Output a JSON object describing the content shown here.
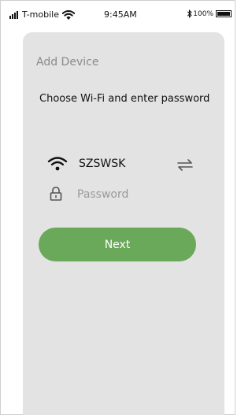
{
  "status_bar": {
    "carrier": "T-mobile",
    "time": "9:45AM",
    "battery": "100%"
  },
  "page": {
    "section_title": "Add Device",
    "subtitle": "Choose Wi-Fi and enter password"
  },
  "wifi": {
    "ssid": "SZSWSK"
  },
  "password": {
    "placeholder": "Password",
    "value": ""
  },
  "actions": {
    "next_label": "Next"
  },
  "colors": {
    "accent": "#6aa85a",
    "panel_background": "#e3e3e3",
    "muted_text": "#8a8a8a"
  },
  "icons": {
    "signal": "signal-bars-icon",
    "wifi_status": "wifi-icon",
    "bluetooth": "bluetooth-icon",
    "battery": "battery-icon",
    "wifi_network": "wifi-icon",
    "switch_network": "swap-arrows-icon",
    "password": "lock-icon"
  }
}
